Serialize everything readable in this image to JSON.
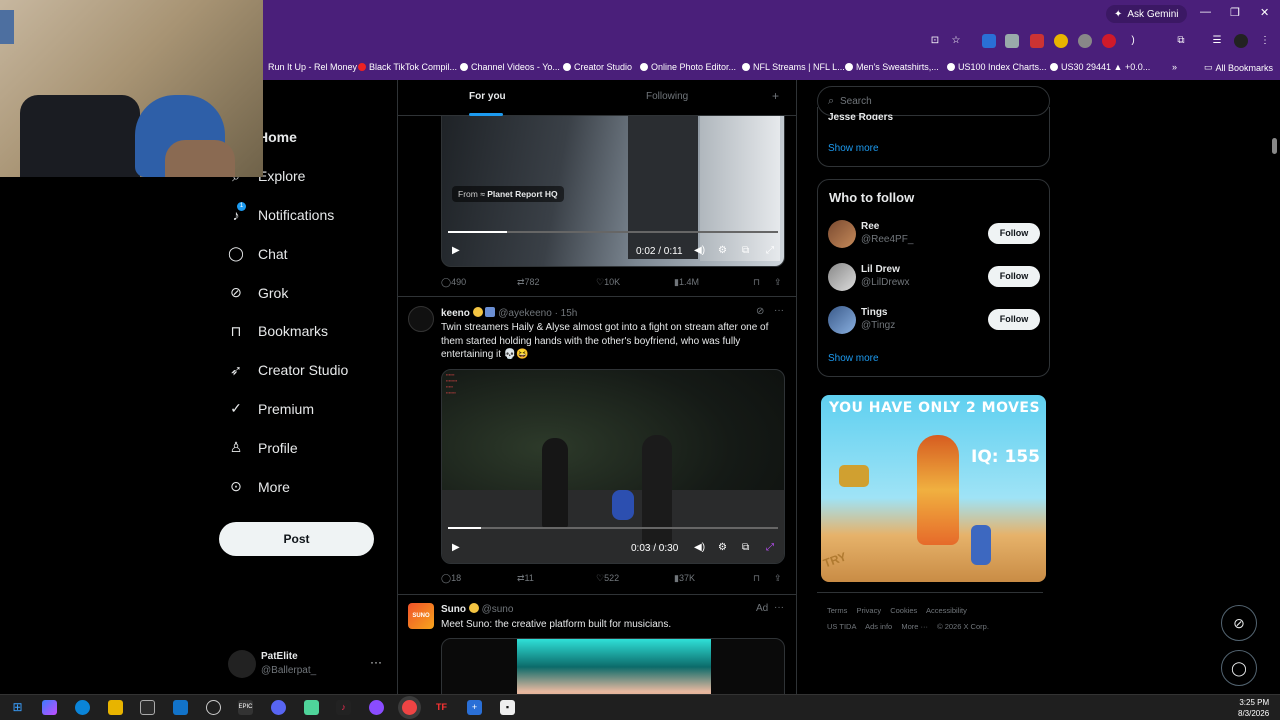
{
  "browser": {
    "ask_gemini": "Ask Gemini",
    "bookmarks": [
      "Run It Up - Rel Money",
      "Black TikTok Compil...",
      "Channel Videos - Yo...",
      "Creator Studio",
      "Online Photo Editor...",
      "NFL Streams | NFL L...",
      "Men's Sweatshirts,...",
      "US100 Index Charts...",
      "US30 29441 ▲ +0.0..."
    ],
    "all_bookmarks": "All Bookmarks",
    "bookmark_overflow": "»"
  },
  "sidebar": {
    "items": [
      {
        "label": "Home",
        "icon": "home-icon"
      },
      {
        "label": "Explore",
        "icon": "search-icon"
      },
      {
        "label": "Notifications",
        "icon": "bell-icon",
        "badge": "1"
      },
      {
        "label": "Chat",
        "icon": "chat-icon"
      },
      {
        "label": "Grok",
        "icon": "grok-icon"
      },
      {
        "label": "Bookmarks",
        "icon": "bookmark-icon"
      },
      {
        "label": "Creator Studio",
        "icon": "rocket-icon"
      },
      {
        "label": "Premium",
        "icon": "verified-icon"
      },
      {
        "label": "Profile",
        "icon": "person-icon"
      },
      {
        "label": "More",
        "icon": "more-circle-icon"
      }
    ],
    "post_label": "Post",
    "account": {
      "name": "PatElite",
      "handle": "@Ballerpat_",
      "more": "···"
    }
  },
  "feed": {
    "tabs": {
      "for_you": "For you",
      "following": "Following",
      "add": "+"
    },
    "tweet1": {
      "from_label": "From",
      "from_source": "Planet Report HQ",
      "time": "0:02 / 0:11",
      "progress": 0.18,
      "stats": {
        "replies": "490",
        "reposts": "782",
        "likes": "10K",
        "views": "1.4M"
      }
    },
    "tweet2": {
      "name": "keeno",
      "handle": "@ayekeeno",
      "age": "· 15h",
      "more": "···",
      "text": "Twin streamers Haily & Alyse almost got into a fight on stream after one of them started holding hands with the other's boyfriend, who was fully entertaining it 💀😆",
      "time": "0:03 / 0:30",
      "progress": 0.1,
      "stats": {
        "replies": "18",
        "reposts": "11",
        "likes": "522",
        "views": "37K"
      }
    },
    "tweet3": {
      "name": "Suno",
      "handle": "@suno",
      "ad_label": "Ad",
      "more": "···",
      "text": "Meet Suno: the creative platform built for musicians.",
      "avatar_text": "SUNO"
    }
  },
  "right": {
    "search_placeholder": "Search",
    "trend_tail": "Jesse Rogers",
    "show_more": "Show more",
    "who_to_follow": {
      "title": "Who to follow",
      "people": [
        {
          "name": "Ree",
          "handle": "@Ree4PF_",
          "button": "Follow"
        },
        {
          "name": "Lil Drew",
          "handle": "@LilDrewx",
          "button": "Follow"
        },
        {
          "name": "Tings",
          "handle": "@Tingz",
          "button": "Follow"
        }
      ],
      "show_more": "Show more"
    },
    "ad_banner": {
      "line1": "YOU HAVE ONLY 2 MOVES",
      "line2": "IQ: 155",
      "try": "TRY"
    },
    "footer": [
      "Terms",
      "Privacy",
      "Cookies",
      "Accessibility",
      "US TIDA",
      "Ads info",
      "More ···",
      "© 2026 X Corp."
    ]
  },
  "taskbar": {
    "time": "3:25 PM",
    "date": "8/3/2026"
  },
  "colors": {
    "accent": "#1d9bf0",
    "chrome": "#4a1f7a",
    "background": "#000000"
  }
}
